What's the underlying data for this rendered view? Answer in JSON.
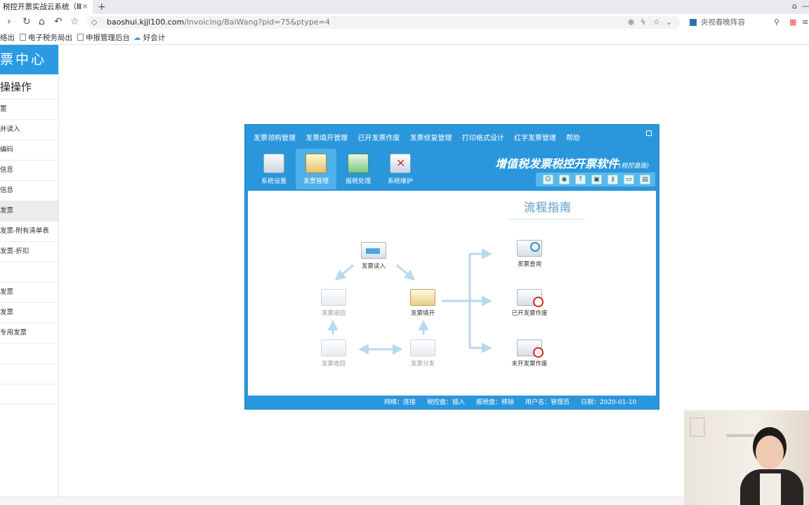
{
  "browser": {
    "tab_title": "税控开票实战云系统（Ⅲ",
    "tab_close": "×",
    "new_tab": "+",
    "url_host": "baoshui.kjjl100.com",
    "url_path": "/Invoicing/BaiWang?pid=75&ptype=4",
    "search_text": "央视春晚阵容",
    "bookmarks": [
      {
        "label": "络出"
      },
      {
        "label": "电子税务局出"
      },
      {
        "label": "申报管理后台"
      },
      {
        "label": "好会计"
      }
    ]
  },
  "sidebar": {
    "header": "票中心",
    "subheader": "操操作",
    "items": [
      {
        "label": "置"
      },
      {
        "label": "并读入"
      },
      {
        "label": "编码"
      },
      {
        "label": "信息"
      },
      {
        "label": "信息"
      },
      {
        "label": "发票"
      },
      {
        "label": "发票-附有清单表"
      },
      {
        "label": "发票-折扣"
      },
      {
        "label": ""
      },
      {
        "label": "发票"
      },
      {
        "label": "发票"
      },
      {
        "label": "专用发票"
      },
      {
        "label": ""
      },
      {
        "label": ""
      },
      {
        "label": ""
      }
    ],
    "active_index": 5
  },
  "app": {
    "menu": [
      "发票领购管理",
      "发票填开管理",
      "已开发票作废",
      "发票修复管理",
      "打印格式设计",
      "红字发票管理",
      "帮助"
    ],
    "tools": [
      {
        "label": "系统设置"
      },
      {
        "label": "发票管理"
      },
      {
        "label": "报税处理"
      },
      {
        "label": "系统维护"
      }
    ],
    "selected_tool": 1,
    "title": "增值税发票税控开票软件",
    "title_suffix": "(税控盘版)",
    "guide_title": "流程指南",
    "nodes": {
      "read_in": "发票读入",
      "fill": "发票填开",
      "return": "发票退回",
      "recover": "发票收回",
      "distribute": "发票分发",
      "query": "发票查询",
      "void_issued": "已开发票作废",
      "void_blank": "未开发票作废"
    },
    "status": {
      "network": "网络：连接",
      "tax_disk": "税控盘：插入",
      "report_disk": "报税盘：移除",
      "user": "用户名：管理员",
      "date": "日期：2020-01-10"
    },
    "colors": {
      "frame": "#2a96dc",
      "arrow": "#b9d9ef",
      "accent": "#4ea4e2"
    }
  }
}
